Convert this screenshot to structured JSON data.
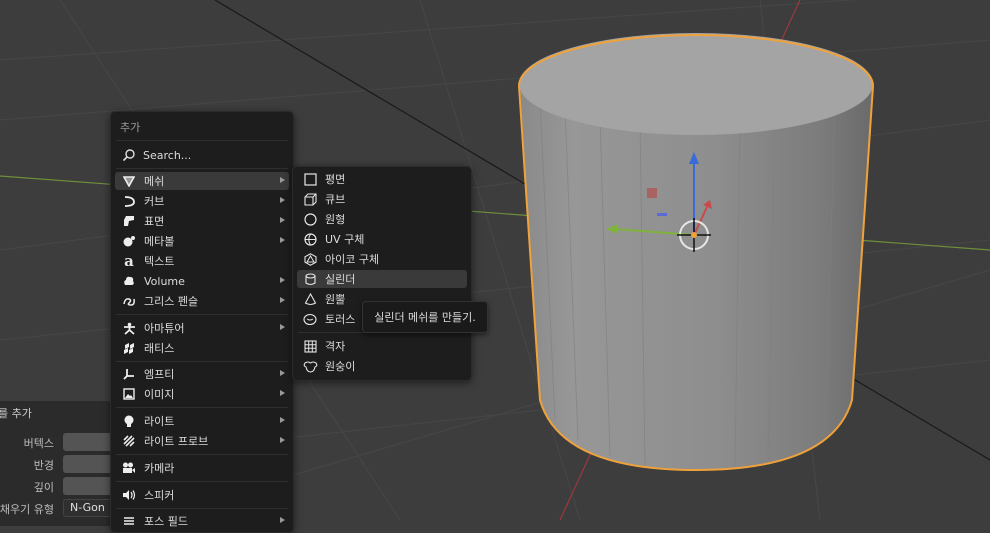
{
  "add_menu": {
    "title": "추가",
    "search": "Search...",
    "items": {
      "mesh": "메쉬",
      "curve": "커브",
      "surface": "표면",
      "metaball": "메타볼",
      "text": "텍스트",
      "volume": "Volume",
      "grease_pencil": "그리스 펜슬",
      "armature": "아마튜어",
      "lattice": "래티스",
      "empty": "엠프티",
      "image": "이미지",
      "light": "라이트",
      "light_probe": "라이트 프로브",
      "camera": "카메라",
      "speaker": "스피커",
      "force_field": "포스 필드"
    }
  },
  "mesh_menu": {
    "plane": "평면",
    "cube": "큐브",
    "circle": "원형",
    "uv_sphere": "UV 구체",
    "ico_sphere": "아이코 구체",
    "cylinder": "실린더",
    "cone": "원뿔",
    "torus": "토러스",
    "grid": "격자",
    "monkey": "원숭이"
  },
  "tooltip": "실린더 메쉬를 만들기.",
  "redo_panel": {
    "title": "를 추가",
    "vertices_label": "버텍스",
    "radius_label": "반경",
    "depth_label": "깊이",
    "fill_type_label": "채우기 유형",
    "fill_type_value": "N-Gon"
  },
  "colors": {
    "viewport_bg": "#3d3d3d",
    "selection_outline": "#f0a23a",
    "menu_bg": "#1d1d1d",
    "menu_active": "#3a3a3a",
    "x_axis": "#c94a4a",
    "y_axis": "#7fb33a",
    "z_axis": "#3a6ad8"
  }
}
